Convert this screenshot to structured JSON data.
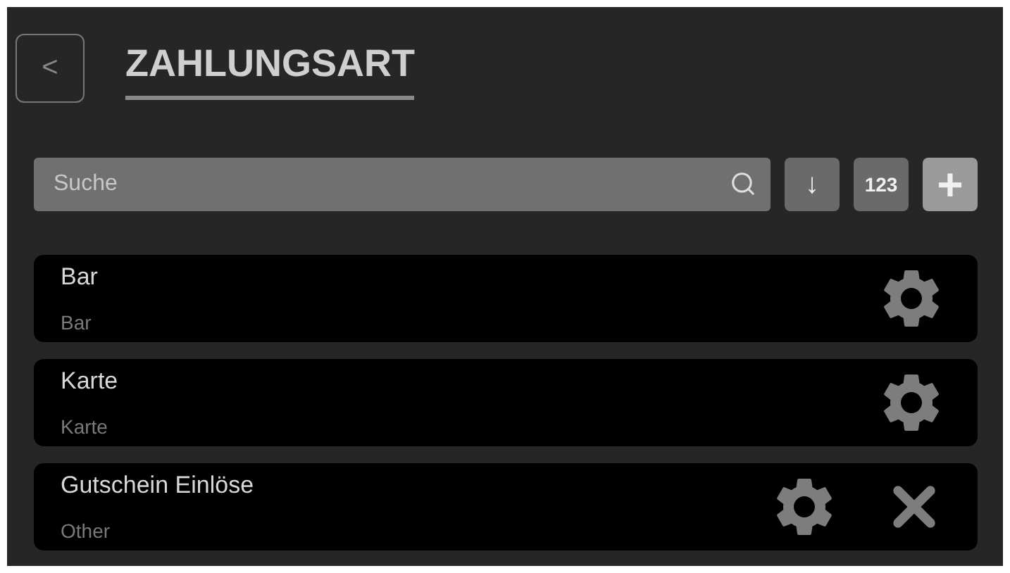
{
  "header": {
    "back_icon": "<",
    "title": "ZAHLUNGSART"
  },
  "toolbar": {
    "search": {
      "placeholder": "Suche"
    },
    "sort_button": "↓",
    "number_button": "123",
    "add_button": "+"
  },
  "payment_types": [
    {
      "name": "Bar",
      "type": "Bar",
      "removable": false
    },
    {
      "name": "Karte",
      "type": "Karte",
      "removable": false
    },
    {
      "name": "Gutschein Einlöse",
      "type": "Other",
      "removable": true
    }
  ]
}
